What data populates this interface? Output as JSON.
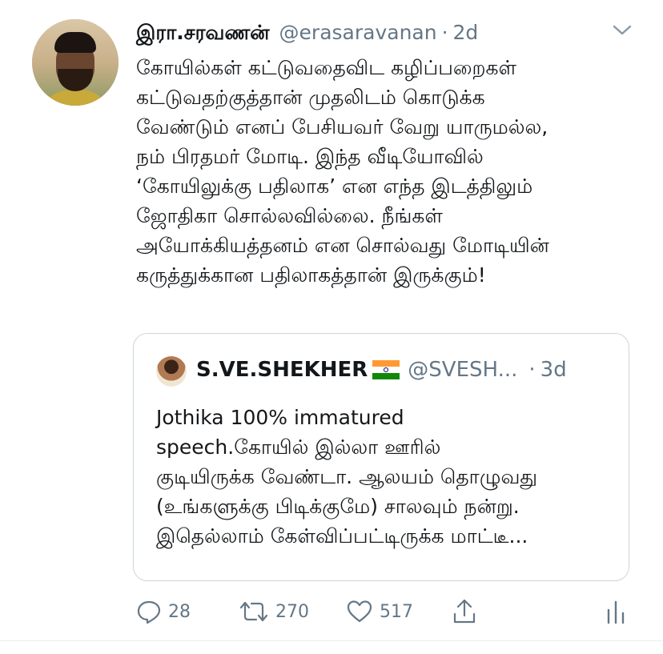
{
  "tweet": {
    "author_name": "இரா.சரவணன்",
    "author_handle": "@erasaravanan",
    "separator": "·",
    "time": "2d",
    "text": "கோயில்கள் கட்டுவதைவிட கழிப்பறைகள்\nகட்டுவதற்குத்தான் முதலிடம் கொடுக்க\nவேண்டும் எனப் பேசியவர் வேறு யாருமல்ல,\nநம் பிரதமர் மோடி. இந்த வீடியோவில்\n‘கோயிலுக்கு பதிலாக’ என எந்த இடத்திலும்\nஜோதிகா சொல்லவில்லை. நீங்கள்\nஅயோக்கியத்தனம் என சொல்வது மோடியின்\nகருத்துக்கான பதிலாகத்தான் இருக்கும்!"
  },
  "quoted": {
    "author_name": "S.VE.SHEKHER",
    "author_handle": "@SVESH...",
    "separator": "·",
    "time": "3d",
    "text": "Jothika 100% immatured\nspeech.கோயில் இல்லா ஊரில்\nகுடியிருக்க வேண்டா. ஆலயம் தொழுவது\n(உங்களுக்கு பிடிக்குமே) சாலவும் நன்று.\nஇதெல்லாம் கேள்விப்பட்டிருக்க மாட்டீ..."
  },
  "actions": {
    "reply_count": "28",
    "retweet_count": "270",
    "like_count": "517"
  },
  "icons": [
    "chevron-down-icon",
    "reply-icon",
    "retweet-icon",
    "heart-icon",
    "share-icon",
    "analytics-icon",
    "india-flag-icon"
  ],
  "colors": {
    "text": "#14171a",
    "secondary": "#657786",
    "border": "#ccd6dd"
  }
}
